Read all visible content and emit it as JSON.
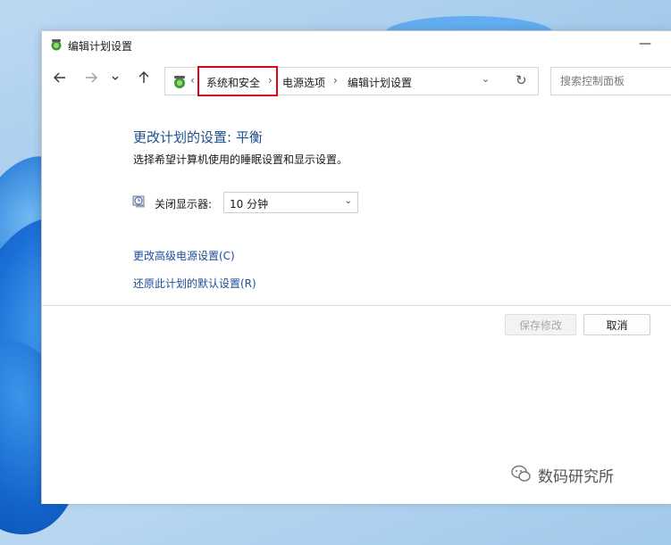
{
  "window": {
    "title": "编辑计划设置",
    "minimize_symbol": "—"
  },
  "nav": {
    "back_icon": "arrow-left-icon",
    "forward_icon": "arrow-right-icon",
    "recent_icon": "chevron-down-icon",
    "up_icon": "arrow-up-icon"
  },
  "address": {
    "lead_separator": "‹",
    "crumbs": [
      "系统和安全",
      "电源选项",
      "编辑计划设置"
    ],
    "separator": "›",
    "dropdown_symbol": "⌄",
    "refresh_symbol": "↻"
  },
  "search": {
    "placeholder": "搜索控制面板"
  },
  "main": {
    "heading": "更改计划的设置: 平衡",
    "subheading": "选择希望计算机使用的睡眠设置和显示设置。",
    "display_off_label": "关闭显示器:",
    "display_off_value": "10 分钟",
    "select_chevron": "⌄",
    "advanced_link": "更改高级电源设置(C)",
    "restore_link": "还原此计划的默认设置(R)"
  },
  "buttons": {
    "save": "保存修改",
    "cancel": "取消"
  },
  "watermark": {
    "text": "数码研究所"
  },
  "colors": {
    "heading": "#1e4f8c",
    "link": "#1b4e9b",
    "highlight": "#e0001b"
  }
}
